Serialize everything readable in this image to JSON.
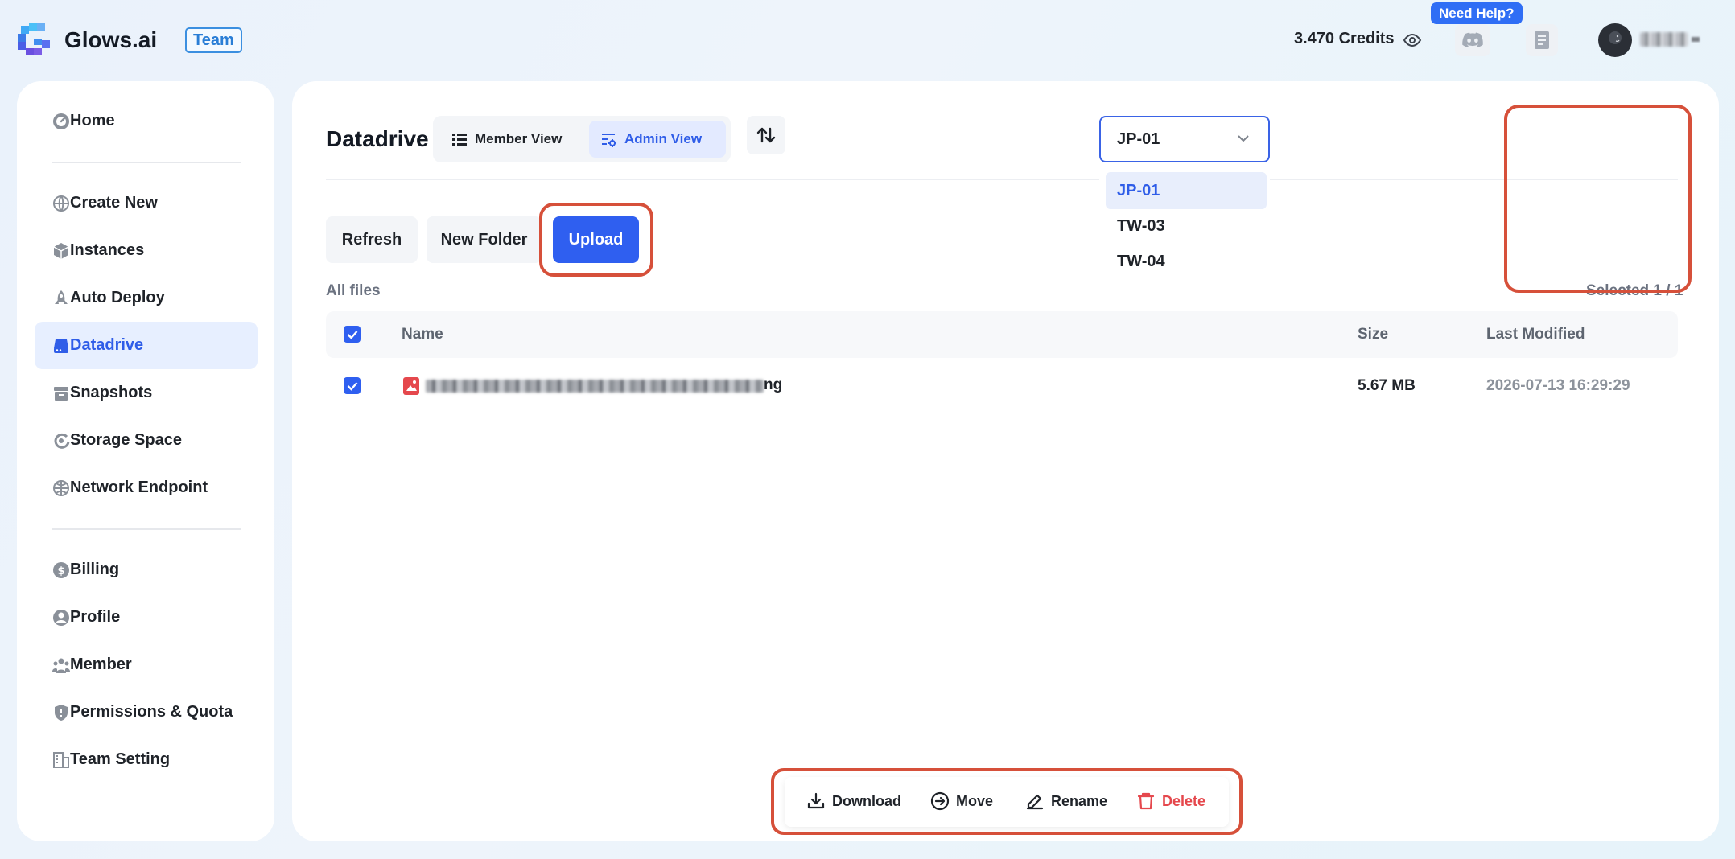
{
  "header": {
    "brand": "Glows.ai",
    "badge": "Team",
    "credits": "3.470 Credits",
    "help_label": "Need Help?"
  },
  "sidebar": {
    "items": [
      {
        "label": "Home",
        "icon": "gauge-icon"
      },
      {
        "label": "Create New",
        "icon": "globe-icon"
      },
      {
        "label": "Instances",
        "icon": "cube-icon"
      },
      {
        "label": "Auto Deploy",
        "icon": "rocket-icon"
      },
      {
        "label": "Datadrive",
        "icon": "drive-icon",
        "active": true
      },
      {
        "label": "Snapshots",
        "icon": "archive-icon"
      },
      {
        "label": "Storage Space",
        "icon": "storage-icon"
      },
      {
        "label": "Network Endpoint",
        "icon": "network-icon"
      },
      {
        "label": "Billing",
        "icon": "dollar-icon"
      },
      {
        "label": "Profile",
        "icon": "user-icon"
      },
      {
        "label": "Member",
        "icon": "members-icon"
      },
      {
        "label": "Permissions & Quota",
        "icon": "shield-icon"
      },
      {
        "label": "Team Setting",
        "icon": "building-icon"
      }
    ]
  },
  "main": {
    "title": "Datadrive",
    "views": {
      "member": "Member View",
      "admin": "Admin View"
    },
    "actions": {
      "refresh": "Refresh",
      "new_folder": "New Folder",
      "upload": "Upload"
    },
    "all_files": "All files",
    "selected_count": "Selected 1 / 1",
    "columns": {
      "name": "Name",
      "size": "Size",
      "modified": "Last Modified"
    },
    "rows": [
      {
        "name_ext": "ng",
        "size": "5.67 MB",
        "modified": "2026-07-13 16:29:29"
      }
    ]
  },
  "region": {
    "selected": "JP-01",
    "options": [
      "JP-01",
      "TW-03",
      "TW-04"
    ]
  },
  "bottom_bar": {
    "download": "Download",
    "move": "Move",
    "rename": "Rename",
    "delete": "Delete"
  },
  "colors": {
    "accent": "#2f5ff0",
    "highlight": "#d6503a",
    "danger": "#e5484d"
  }
}
